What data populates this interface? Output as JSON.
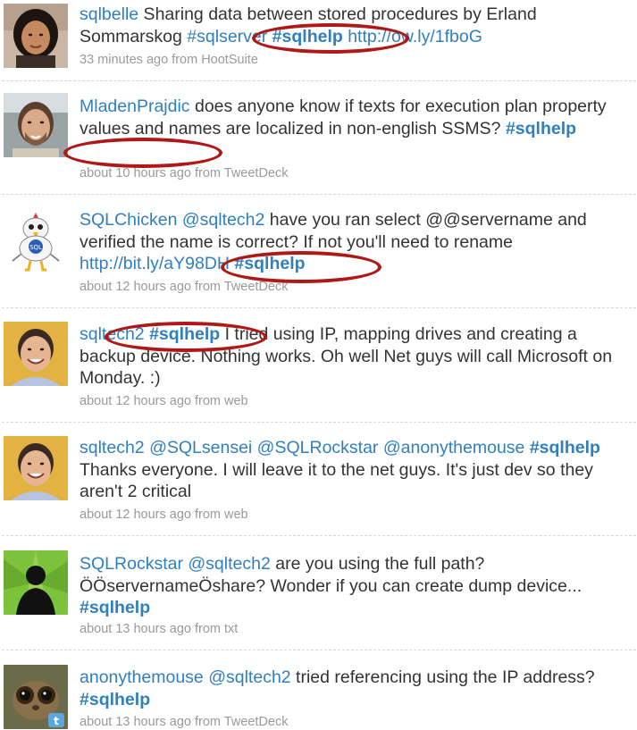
{
  "tweets": [
    {
      "user": "sqlbelle",
      "avatar_icon": "user-photo-woman",
      "parts": [
        {
          "t": "text",
          "v": " Sharing data between stored procedures by Erland Sommarskog "
        },
        {
          "t": "hashtag-plain",
          "v": "#sqlserver"
        },
        {
          "t": "text",
          "v": " "
        },
        {
          "t": "hashtag",
          "v": "#sqlhelp"
        },
        {
          "t": "text",
          "v": " "
        },
        {
          "t": "link",
          "v": "http://ow.ly/1fboG"
        }
      ],
      "meta": "33 minutes ago from HootSuite"
    },
    {
      "user": "MladenPrajdic",
      "avatar_icon": "user-photo-man-beard",
      "parts": [
        {
          "t": "text",
          "v": " does anyone know if texts for execution plan property values and names are localized in non-english SSMS? "
        },
        {
          "t": "hashtag",
          "v": "#sqlhelp"
        }
      ],
      "meta": "about 10 hours ago from TweetDeck"
    },
    {
      "user": "SQLChicken",
      "avatar_icon": "chicken-cartoon-icon",
      "parts": [
        {
          "t": "text",
          "v": " "
        },
        {
          "t": "mention",
          "v": "@sqltech2"
        },
        {
          "t": "text",
          "v": " have you ran select @@servername and verified the name is correct? If not you'll need to rename "
        },
        {
          "t": "link",
          "v": "http://bit.ly/aY98DH"
        },
        {
          "t": "text",
          "v": " "
        },
        {
          "t": "hashtag",
          "v": "#sqlhelp"
        }
      ],
      "meta": "about 12 hours ago from TweetDeck"
    },
    {
      "user": "sqltech2",
      "avatar_icon": "user-photo-man-smiling",
      "parts": [
        {
          "t": "text",
          "v": " "
        },
        {
          "t": "hashtag",
          "v": "#sqlhelp"
        },
        {
          "t": "text",
          "v": " I tried using IP, mapping drives and creating a backup device. Nothing works. Oh well Net guys will call Microsoft on Monday. :)"
        }
      ],
      "meta": "about 12 hours ago from web"
    },
    {
      "user": "sqltech2",
      "avatar_icon": "user-photo-man-smiling",
      "parts": [
        {
          "t": "text",
          "v": " "
        },
        {
          "t": "mention",
          "v": "@SQLsensei"
        },
        {
          "t": "text",
          "v": " "
        },
        {
          "t": "mention",
          "v": "@SQLRockstar"
        },
        {
          "t": "text",
          "v": " "
        },
        {
          "t": "mention",
          "v": "@anonythemouse"
        },
        {
          "t": "text",
          "v": " "
        },
        {
          "t": "hashtag",
          "v": "#sqlhelp"
        },
        {
          "t": "text",
          "v": " Thanks everyone. I will leave it to the net guys. It's just dev so they aren't 2 critical"
        }
      ],
      "meta": "about 12 hours ago from web"
    },
    {
      "user": "SQLRockstar",
      "avatar_icon": "silhouette-green-icon",
      "parts": [
        {
          "t": "text",
          "v": " "
        },
        {
          "t": "mention",
          "v": "@sqltech2"
        },
        {
          "t": "text",
          "v": " are you using the full path? ÖÖservernameÖshare? Wonder if you can create dump device... "
        },
        {
          "t": "hashtag",
          "v": "#sqlhelp"
        }
      ],
      "meta": "about 13 hours ago from txt"
    },
    {
      "user": "anonythemouse",
      "avatar_icon": "tarsier-photo-icon",
      "parts": [
        {
          "t": "text",
          "v": " "
        },
        {
          "t": "mention",
          "v": "@sqltech2"
        },
        {
          "t": "text",
          "v": " tried referencing using the IP address? "
        },
        {
          "t": "hashtag",
          "v": "#sqlhelp"
        }
      ],
      "meta": "about 13 hours ago from TweetDeck"
    }
  ],
  "colors": {
    "link": "#2f7fc1",
    "text": "#333333",
    "meta": "#9a9a9a",
    "highlight_circle": "#b01818"
  }
}
